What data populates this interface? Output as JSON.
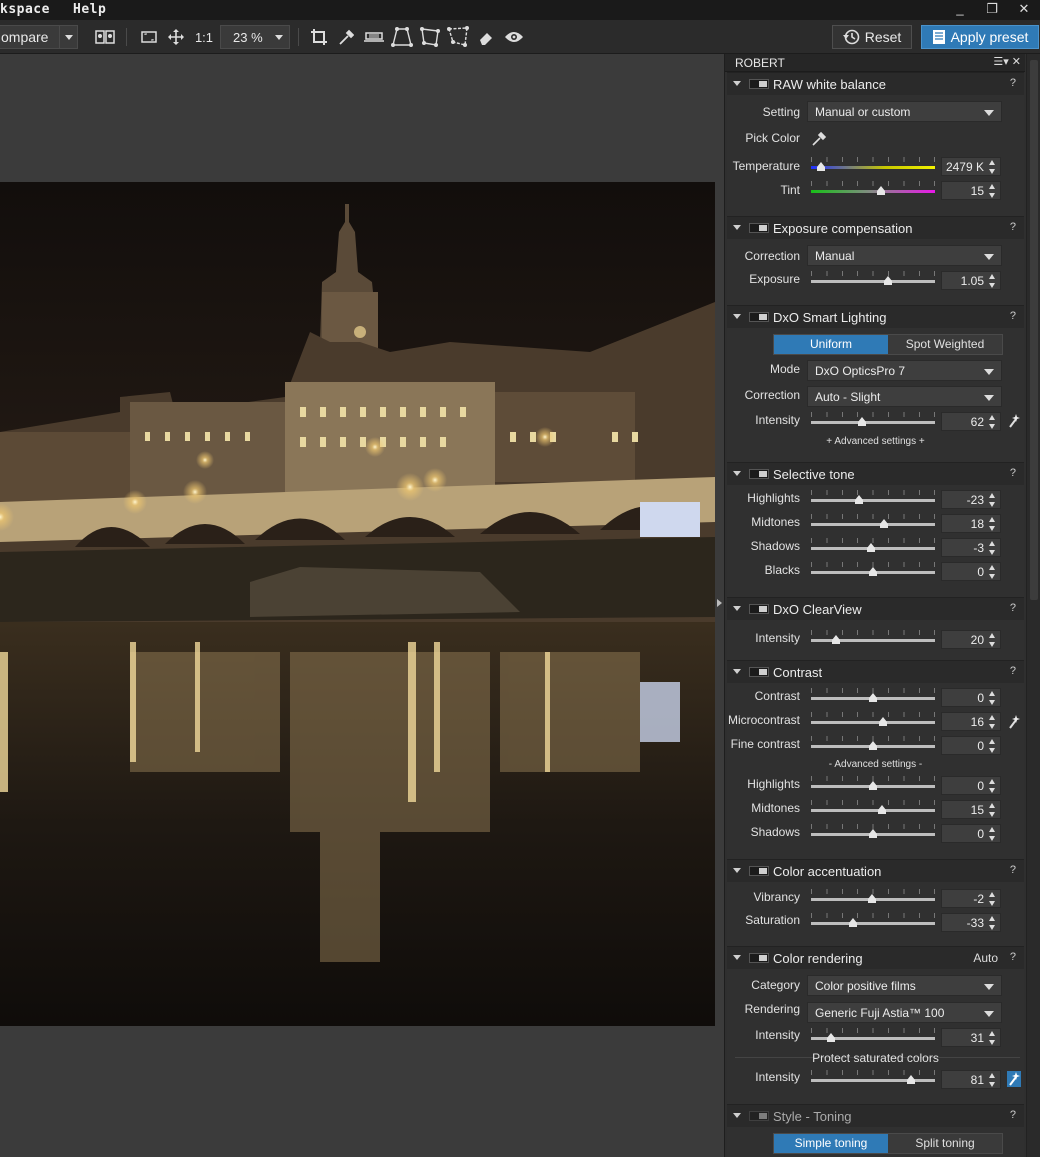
{
  "menubar": {
    "items": [
      "kspace",
      "Help"
    ],
    "minimize": "_",
    "restore": "❐",
    "close": "✕"
  },
  "toolbar": {
    "compare_label": "ompare",
    "zoom_one_to_one": "1:1",
    "zoom_value": "23 %",
    "reset_label": "Reset",
    "apply_preset_label": "Apply preset"
  },
  "panel": {
    "title": "ROBERT",
    "sections": {
      "raw_wb": {
        "title": "RAW white balance",
        "setting_label": "Setting",
        "setting_value": "Manual or custom",
        "pick_color_label": "Pick Color",
        "temperature_label": "Temperature",
        "temperature_value": "2479 K",
        "tint_label": "Tint",
        "tint_value": "15"
      },
      "exposure": {
        "title": "Exposure compensation",
        "correction_label": "Correction",
        "correction_value": "Manual",
        "exposure_label": "Exposure",
        "exposure_value": "1.05"
      },
      "smart_lighting": {
        "title": "DxO Smart Lighting",
        "seg_uniform": "Uniform",
        "seg_spot": "Spot Weighted",
        "mode_label": "Mode",
        "mode_value": "DxO OpticsPro 7",
        "correction_label": "Correction",
        "correction_value": "Auto - Slight",
        "intensity_label": "Intensity",
        "intensity_value": "62",
        "advanced": "+ Advanced settings +"
      },
      "selective_tone": {
        "title": "Selective tone",
        "rows": [
          {
            "label": "Highlights",
            "value": "-23",
            "pos": 0.385
          },
          {
            "label": "Midtones",
            "value": "18",
            "pos": 0.59
          },
          {
            "label": "Shadows",
            "value": "-3",
            "pos": 0.485
          },
          {
            "label": "Blacks",
            "value": "0",
            "pos": 0.5
          }
        ]
      },
      "clearview": {
        "title": "DxO ClearView",
        "intensity_label": "Intensity",
        "intensity_value": "20"
      },
      "contrast": {
        "title": "Contrast",
        "rows": [
          {
            "label": "Contrast",
            "value": "0",
            "pos": 0.5
          },
          {
            "label": "Microcontrast",
            "value": "16",
            "pos": 0.58
          },
          {
            "label": "Fine contrast",
            "value": "0",
            "pos": 0.5
          }
        ],
        "advanced": "- Advanced settings -",
        "rows2": [
          {
            "label": "Highlights",
            "value": "0",
            "pos": 0.5
          },
          {
            "label": "Midtones",
            "value": "15",
            "pos": 0.575
          },
          {
            "label": "Shadows",
            "value": "0",
            "pos": 0.5
          }
        ]
      },
      "color_accent": {
        "title": "Color accentuation",
        "vibrancy_label": "Vibrancy",
        "vibrancy_value": "-2",
        "saturation_label": "Saturation",
        "saturation_value": "-33"
      },
      "color_rendering": {
        "title": "Color rendering",
        "auto_label": "Auto",
        "category_label": "Category",
        "category_value": "Color positive films",
        "rendering_label": "Rendering",
        "rendering_value": "Generic Fuji Astia™ 100",
        "intensity_label": "Intensity",
        "intensity_value": "31",
        "protect_label": "Protect saturated colors",
        "protect_intensity_label": "Intensity",
        "protect_intensity_value": "81"
      },
      "style_toning": {
        "title": "Style - Toning",
        "seg_simple": "Simple toning",
        "seg_split": "Split toning"
      }
    },
    "help_glyph": "?"
  },
  "colors": {
    "accent": "#2f7ab6",
    "panel_bg": "#2f2f2f",
    "viewer_bg": "#3b3b3b"
  }
}
